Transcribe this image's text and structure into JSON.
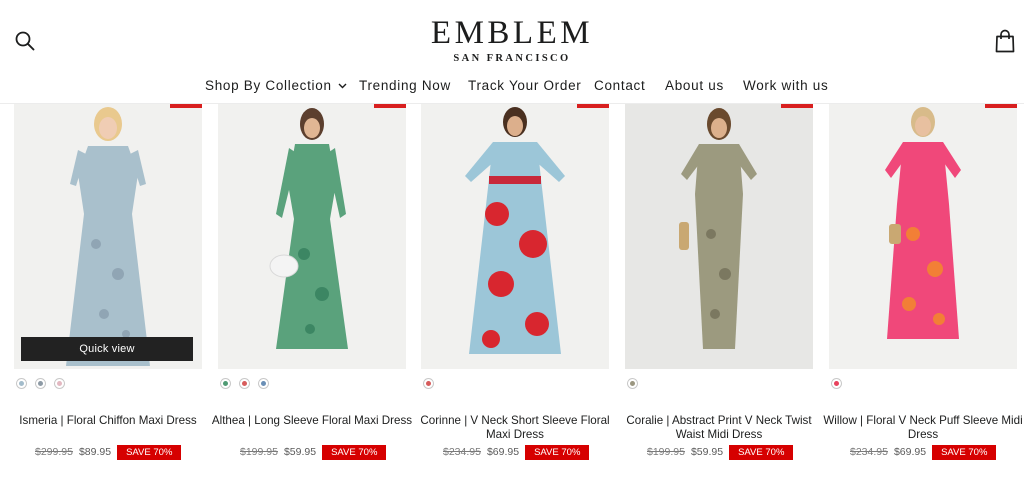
{
  "header": {
    "logo_main": "EMBLEM",
    "logo_sub": "SAN FRANCISCO",
    "search_icon": "search-icon",
    "cart_icon": "shopping-bag-icon"
  },
  "nav": {
    "items": [
      {
        "label": "Shop By Collection",
        "has_dropdown": true
      },
      {
        "label": "Trending Now"
      },
      {
        "label": "Track Your Order"
      },
      {
        "label": "Contact"
      },
      {
        "label": "About us"
      },
      {
        "label": "Work with us"
      }
    ]
  },
  "accent_color": "#d60000",
  "products": [
    {
      "title": "Ismeria | Floral Chiffon Maxi Dress",
      "compare_price": "$299.95",
      "price": "$89.95",
      "badge": "SAVE 70%",
      "quick_view": "Quick view",
      "dress_color": "#a9c0cc",
      "swatches": [
        "#a3bccb",
        "#8d9aa5",
        "#e3b8c1"
      ]
    },
    {
      "title": "Althea | Long Sleeve Floral Maxi Dress",
      "compare_price": "$199.95",
      "price": "$59.95",
      "badge": "SAVE 70%",
      "dress_color": "#5aa27c",
      "swatches": [
        "#4f9a73",
        "#d75c5c",
        "#6a8fb6"
      ]
    },
    {
      "title": "Corinne | V Neck Short Sleeve Floral Maxi Dress",
      "compare_price": "$234.95",
      "price": "$69.95",
      "badge": "SAVE 70%",
      "dress_color": "#9cc6d8",
      "swatches": [
        "#d65b5b"
      ]
    },
    {
      "title": "Coralie | Abstract Print V Neck Twist Waist Midi Dress",
      "compare_price": "$199.95",
      "price": "$59.95",
      "badge": "SAVE 70%",
      "dress_color": "#9c9a7f",
      "swatches": [
        "#9b9781"
      ]
    },
    {
      "title": "Willow | Floral V Neck Puff Sleeve Midi Dress",
      "compare_price": "$234.95",
      "price": "$69.95",
      "badge": "SAVE 70%",
      "dress_color": "#f0487a",
      "swatches": [
        "#e8425d"
      ]
    }
  ]
}
